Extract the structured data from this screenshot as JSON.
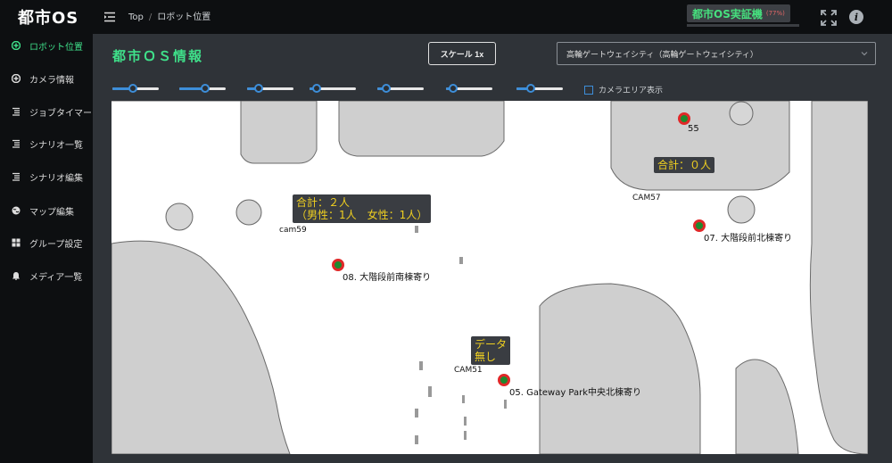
{
  "app": {
    "logo": "都市OS"
  },
  "sidebar": {
    "items": [
      {
        "label": "ロボット位置",
        "icon": "plus-circle-icon",
        "active": true
      },
      {
        "label": "カメラ情報",
        "icon": "plus-circle-icon",
        "active": false
      },
      {
        "label": "ジョブタイマー",
        "icon": "list-icon",
        "active": false
      },
      {
        "label": "シナリオ一覧",
        "icon": "list-icon",
        "active": false
      },
      {
        "label": "シナリオ編集",
        "icon": "list-icon",
        "active": false
      },
      {
        "label": "マップ編集",
        "icon": "globe-icon",
        "active": false
      },
      {
        "label": "グループ設定",
        "icon": "grid-icon",
        "active": false
      },
      {
        "label": "メディア一覧",
        "icon": "bell-icon",
        "active": false
      }
    ]
  },
  "header": {
    "breadcrumb": [
      "Top",
      "ロボット位置"
    ],
    "device_name": "都市OS実証機",
    "device_percent": "(77%)"
  },
  "main": {
    "title": "都市ＯＳ情報",
    "scale_button": "スケール 1x",
    "site_select": "高輪ゲートウェイシティ（高輪ゲートウェイシティ）",
    "sliders": [
      0.45,
      0.55,
      0.25,
      0.15,
      0.2,
      0.15,
      0.3
    ],
    "camera_area_label": "カメラエリア表示",
    "camera_area_checked": false
  },
  "map": {
    "robots": [
      {
        "label": "55"
      },
      {
        "label": "07. 大階段前北棟寄り"
      },
      {
        "label": "08. 大階段前南棟寄り"
      },
      {
        "label": "05. Gateway Park中央北棟寄り"
      }
    ],
    "cameras": [
      {
        "name": "CAM57",
        "count": "合計：０人"
      },
      {
        "name": "cam59",
        "count": "合計：２人\n（男性：1人　女性：1人）"
      },
      {
        "name": "CAM51",
        "count": "データ\n無し"
      }
    ]
  },
  "colors": {
    "accent": "#3fe08a",
    "danger": "#e06666",
    "count_text": "#f0d020",
    "robot_fill": "#1f8a2e",
    "robot_ring": "#e02828"
  }
}
